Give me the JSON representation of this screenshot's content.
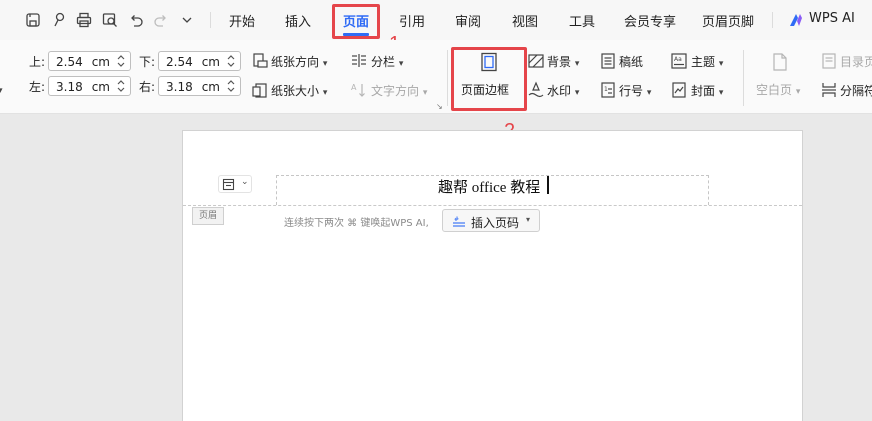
{
  "tabs": [
    "开始",
    "插入",
    "页面",
    "引用",
    "审阅",
    "视图",
    "工具",
    "会员专享",
    "页眉页脚",
    "WPS AI"
  ],
  "active_tab": "页面",
  "margins": {
    "top_label": "上:",
    "top_value": "2.54",
    "top_unit": "cm",
    "bottom_label": "下:",
    "bottom_value": "2.54",
    "bottom_unit": "cm",
    "left_label": "左:",
    "left_value": "3.18",
    "left_unit": "cm",
    "right_label": "右:",
    "right_value": "3.18",
    "right_unit": "cm"
  },
  "ribbon": {
    "orientation": "纸张方向",
    "columns": "分栏",
    "size": "纸张大小",
    "text_direction": "文字方向",
    "page_border": "页面边框",
    "background": "背景",
    "watermark": "水印",
    "manuscript": "稿纸",
    "line_number": "行号",
    "theme": "主题",
    "cover": "封面",
    "blank_page": "空白页",
    "toc_page": "目录页",
    "separator": "分隔符"
  },
  "annotations": {
    "step1": "1",
    "step2": "2"
  },
  "document": {
    "header_text": "趣帮 office 教程",
    "header_badge": "页眉",
    "hint": "连续按下两次 ⌘ 键唤起WPS AI,",
    "insert_page_number": "插入页码"
  },
  "colors": {
    "accent": "#2f6bf5",
    "highlight": "#e5454a"
  }
}
